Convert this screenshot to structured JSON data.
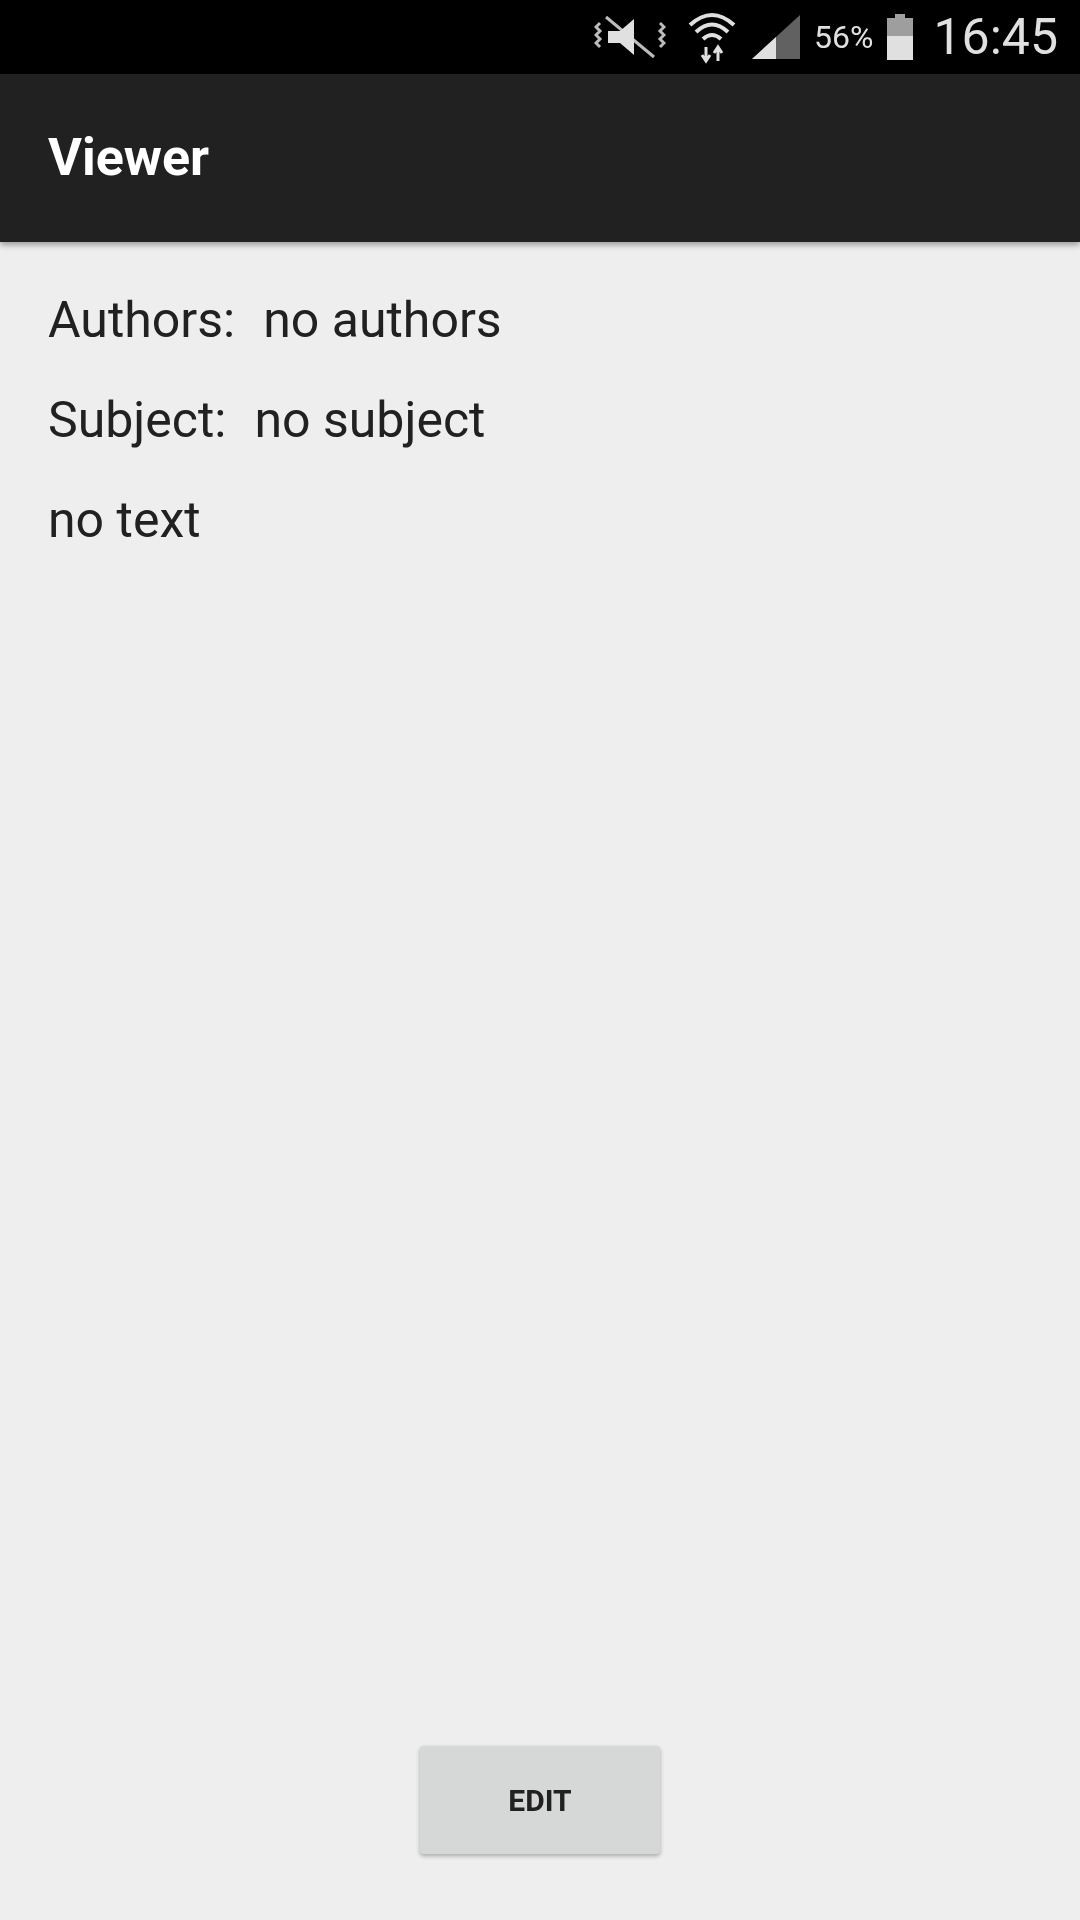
{
  "status_bar": {
    "battery": "56%",
    "time": "16:45"
  },
  "app_bar": {
    "title": "Viewer"
  },
  "fields": [
    {
      "label": "Authors:",
      "value": "no authors"
    },
    {
      "label": "Subject:",
      "value": "no subject"
    }
  ],
  "body": "no text",
  "buttons": [
    "EDIT"
  ]
}
